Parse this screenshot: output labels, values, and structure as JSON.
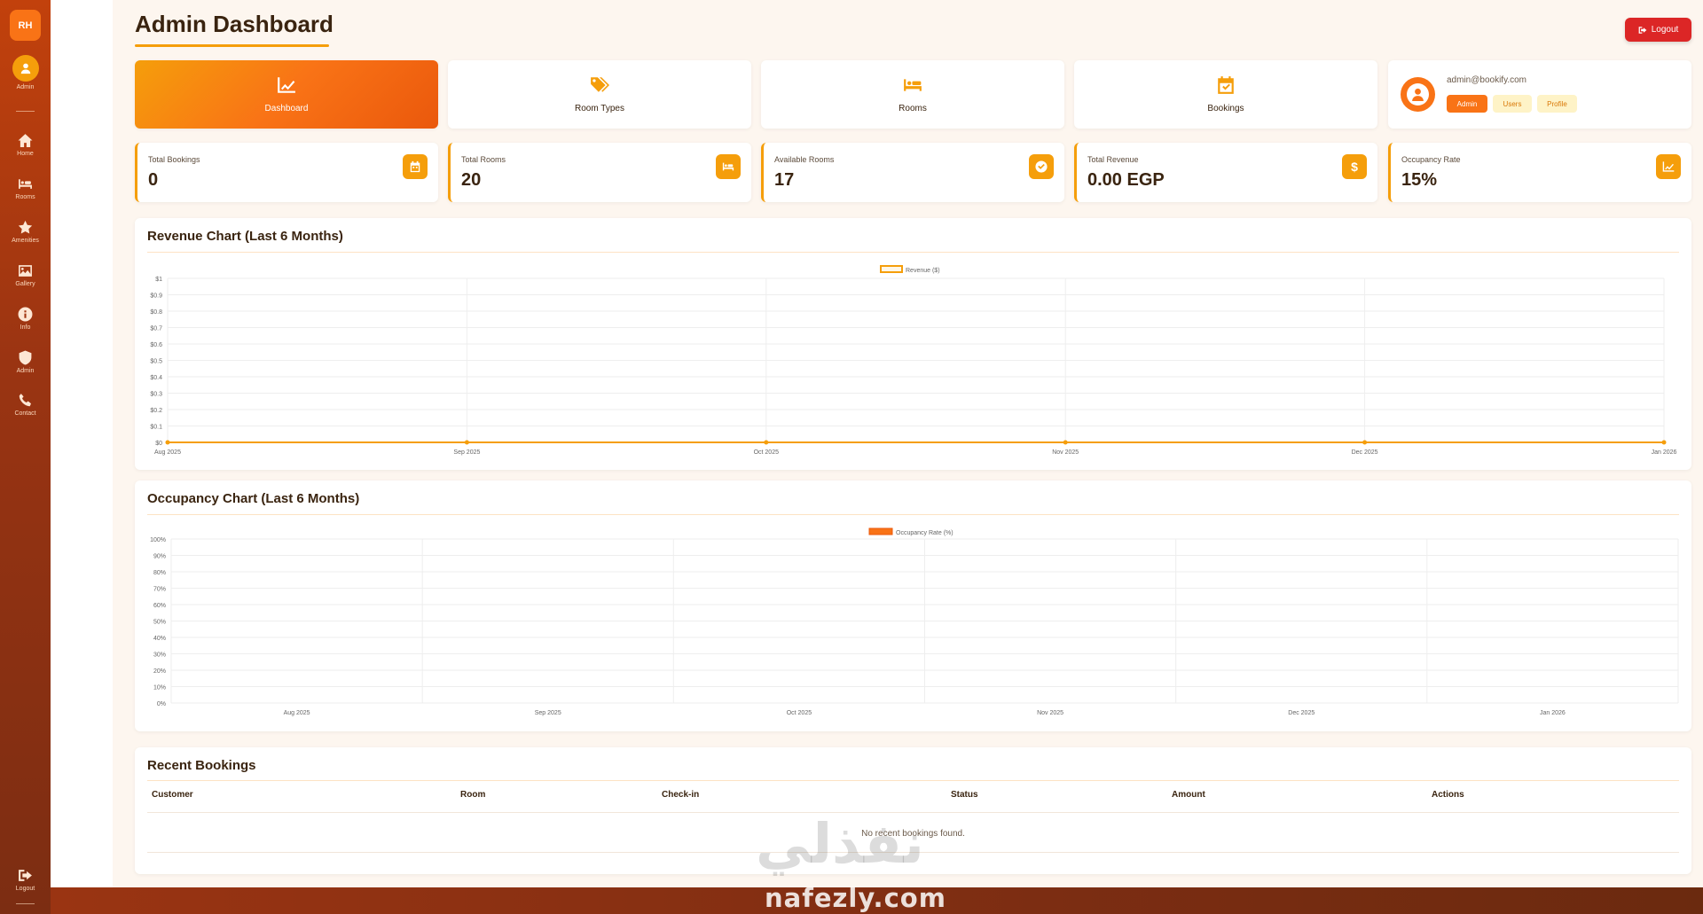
{
  "brand": {
    "initials": "RH"
  },
  "sidebar": {
    "items": [
      {
        "label": "Admin",
        "icon": "user-icon"
      },
      {
        "label": "Home",
        "icon": "home-icon"
      },
      {
        "label": "Rooms",
        "icon": "bed-icon"
      },
      {
        "label": "Amenities",
        "icon": "star-icon"
      },
      {
        "label": "Gallery",
        "icon": "image-icon"
      },
      {
        "label": "Info",
        "icon": "info-icon"
      },
      {
        "label": "Admin",
        "icon": "shield-icon"
      },
      {
        "label": "Contact",
        "icon": "phone-icon"
      },
      {
        "label": "Logout",
        "icon": "logout-icon"
      }
    ]
  },
  "header": {
    "title": "Admin Dashboard",
    "logout_label": "Logout"
  },
  "nav_cards": [
    {
      "label": "Dashboard",
      "icon": "chart-line-icon",
      "active": true
    },
    {
      "label": "Room Types",
      "icon": "tags-icon",
      "active": false
    },
    {
      "label": "Rooms",
      "icon": "bed-icon",
      "active": false
    },
    {
      "label": "Bookings",
      "icon": "calendar-check-icon",
      "active": false
    }
  ],
  "user": {
    "email": "admin@bookify.com",
    "roles": [
      "Admin",
      "Users",
      "Profile"
    ],
    "active_role": "Admin"
  },
  "stats": [
    {
      "label": "Total Bookings",
      "value": "0",
      "icon": "calendar-icon"
    },
    {
      "label": "Total Rooms",
      "value": "20",
      "icon": "bed-icon"
    },
    {
      "label": "Available Rooms",
      "value": "17",
      "icon": "check-circle-icon"
    },
    {
      "label": "Total Revenue",
      "value": "0.00 EGP",
      "icon": "dollar-icon"
    },
    {
      "label": "Occupancy Rate",
      "value": "15%",
      "icon": "chart-line-icon"
    }
  ],
  "chart_data": [
    {
      "type": "line",
      "title": "Revenue Chart (Last 6 Months)",
      "x": [
        "Aug 2025",
        "Sep 2025",
        "Oct 2025",
        "Nov 2025",
        "Dec 2025",
        "Jan 2026"
      ],
      "series": [
        {
          "name": "Revenue ($)",
          "values": [
            0,
            0,
            0,
            0,
            0,
            0
          ],
          "color": "#f59e0b"
        }
      ],
      "y_ticks": [
        "$0",
        "$0.1",
        "$0.2",
        "$0.3",
        "$0.4",
        "$0.5",
        "$0.6",
        "$0.7",
        "$0.8",
        "$0.9",
        "$1"
      ],
      "ylim": [
        0,
        1
      ],
      "legend": "top-center",
      "grid": true
    },
    {
      "type": "bar",
      "title": "Occupancy Chart (Last 6 Months)",
      "categories": [
        "Aug 2025",
        "Sep 2025",
        "Oct 2025",
        "Nov 2025",
        "Dec 2025",
        "Jan 2026"
      ],
      "series": [
        {
          "name": "Occupancy Rate (%)",
          "values": [
            0,
            0,
            0,
            0,
            0,
            0
          ],
          "color": "#f97316"
        }
      ],
      "y_ticks": [
        "0%",
        "10%",
        "20%",
        "30%",
        "40%",
        "50%",
        "60%",
        "70%",
        "80%",
        "90%",
        "100%"
      ],
      "ylim": [
        0,
        100
      ],
      "legend": "top-center",
      "grid": true
    }
  ],
  "recent_bookings": {
    "title": "Recent Bookings",
    "columns": [
      "Customer",
      "Room",
      "Check-in",
      "Status",
      "Amount",
      "Actions"
    ],
    "empty_text": "No recent bookings found."
  },
  "watermark": {
    "arabic": "نفذلي",
    "latin": "nafezly.com"
  },
  "colors": {
    "accent": "#f59e0b",
    "accent_dark": "#ea580c",
    "danger": "#dc2626",
    "sidebar": "#9a3412"
  }
}
